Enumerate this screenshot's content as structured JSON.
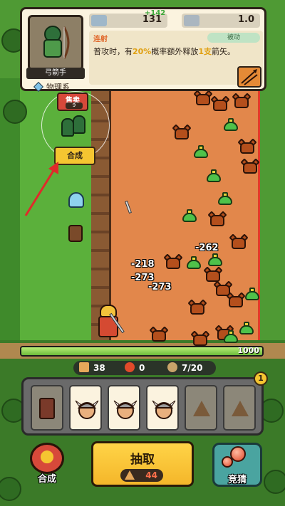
{
  "unit_card": {
    "name": "弓箭手",
    "type": "物理系",
    "attack": "131",
    "attack_bonus": "+142",
    "attack_speed": "1.0",
    "skill": {
      "name": "连射",
      "type": "被动",
      "desc_prefix": "普攻时，有",
      "desc_chance": "20%",
      "desc_mid": "概率额外释放",
      "desc_count": "1支",
      "desc_suffix": "箭矢。"
    }
  },
  "hero_popup": {
    "sell_label": "售卖",
    "sell_value": "9",
    "merge_label": "合成"
  },
  "damage_numbers": [
    "-262",
    "-218",
    "-273",
    "-273"
  ],
  "base_hp": {
    "value": "1000",
    "fraction": 1.0
  },
  "resources": {
    "coins": "38",
    "gems": "0",
    "population": "7/20"
  },
  "tray": {
    "badge": "1",
    "slots": [
      "rune",
      "viking",
      "viking",
      "viking",
      "locked",
      "locked"
    ]
  },
  "actions": {
    "merge": "合成",
    "draw": "抽取",
    "draw_cost": "44",
    "guess": "竞猜"
  },
  "colors": {
    "sand": "#e2874b",
    "accent_yellow": "#f5c531",
    "hp_green": "#6dbb3a",
    "sell_red": "#d7493a",
    "highlight": "#e0a012"
  }
}
